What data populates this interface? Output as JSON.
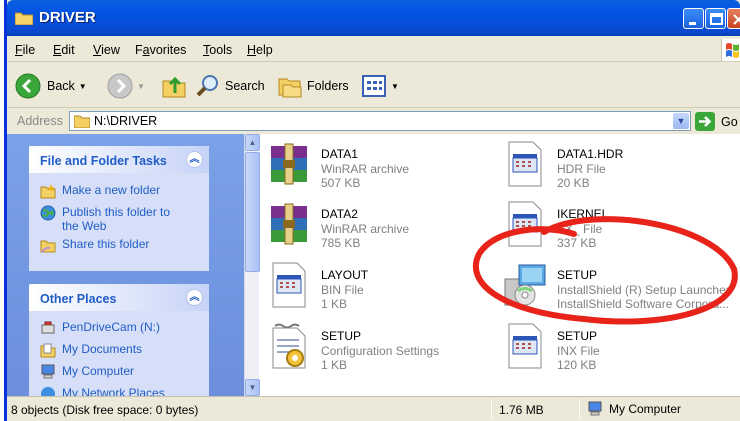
{
  "window": {
    "title": "DRIVER"
  },
  "menu": [
    "File",
    "Edit",
    "View",
    "Favorites",
    "Tools",
    "Help"
  ],
  "menu_accel": [
    "F",
    "E",
    "V",
    "a",
    "T",
    "H"
  ],
  "toolbar": {
    "back_label": "Back",
    "search_label": "Search",
    "folders_label": "Folders"
  },
  "address": {
    "label": "Address",
    "path": "N:\\DRIVER",
    "go_label": "Go"
  },
  "tasks_panel": {
    "title": "File and Folder Tasks",
    "links": [
      "Make a new folder",
      "Publish this folder to",
      "the Web",
      "Share this folder"
    ]
  },
  "places_panel": {
    "title": "Other Places",
    "links": [
      "PenDriveCam (N:)",
      "My Documents",
      "My Computer",
      "My Network Places"
    ]
  },
  "files": [
    {
      "name": "DATA1",
      "type": "WinRAR archive",
      "size": "507 KB",
      "icon": "winrar-archive-icon"
    },
    {
      "name": "DATA2",
      "type": "WinRAR archive",
      "size": "785 KB",
      "icon": "winrar-archive-icon"
    },
    {
      "name": "LAYOUT",
      "type": "BIN File",
      "size": "1 KB",
      "icon": "document-icon"
    },
    {
      "name": "SETUP",
      "type": "Configuration Settings",
      "size": "1 KB",
      "icon": "settings-file-icon"
    },
    {
      "name": "DATA1.HDR",
      "type": "HDR File",
      "size": "20 KB",
      "icon": "document-icon"
    },
    {
      "name": "IKERNEL",
      "type": "EX_ File",
      "size": "337 KB",
      "icon": "document-icon"
    },
    {
      "name": "SETUP",
      "type": "InstallShield (R) Setup Launcher",
      "size": "InstallShield Software Corpora...",
      "icon": "installer-icon"
    },
    {
      "name": "SETUP",
      "type": "INX File",
      "size": "120 KB",
      "icon": "document-icon"
    }
  ],
  "status": {
    "objects": "8 objects (Disk free space: 0 bytes)",
    "size": "1.76 MB",
    "zone": "My Computer"
  },
  "colors": {
    "title_bar": "#0353e2",
    "panel_title": "#215dc6",
    "annotation": "#e8241a"
  }
}
